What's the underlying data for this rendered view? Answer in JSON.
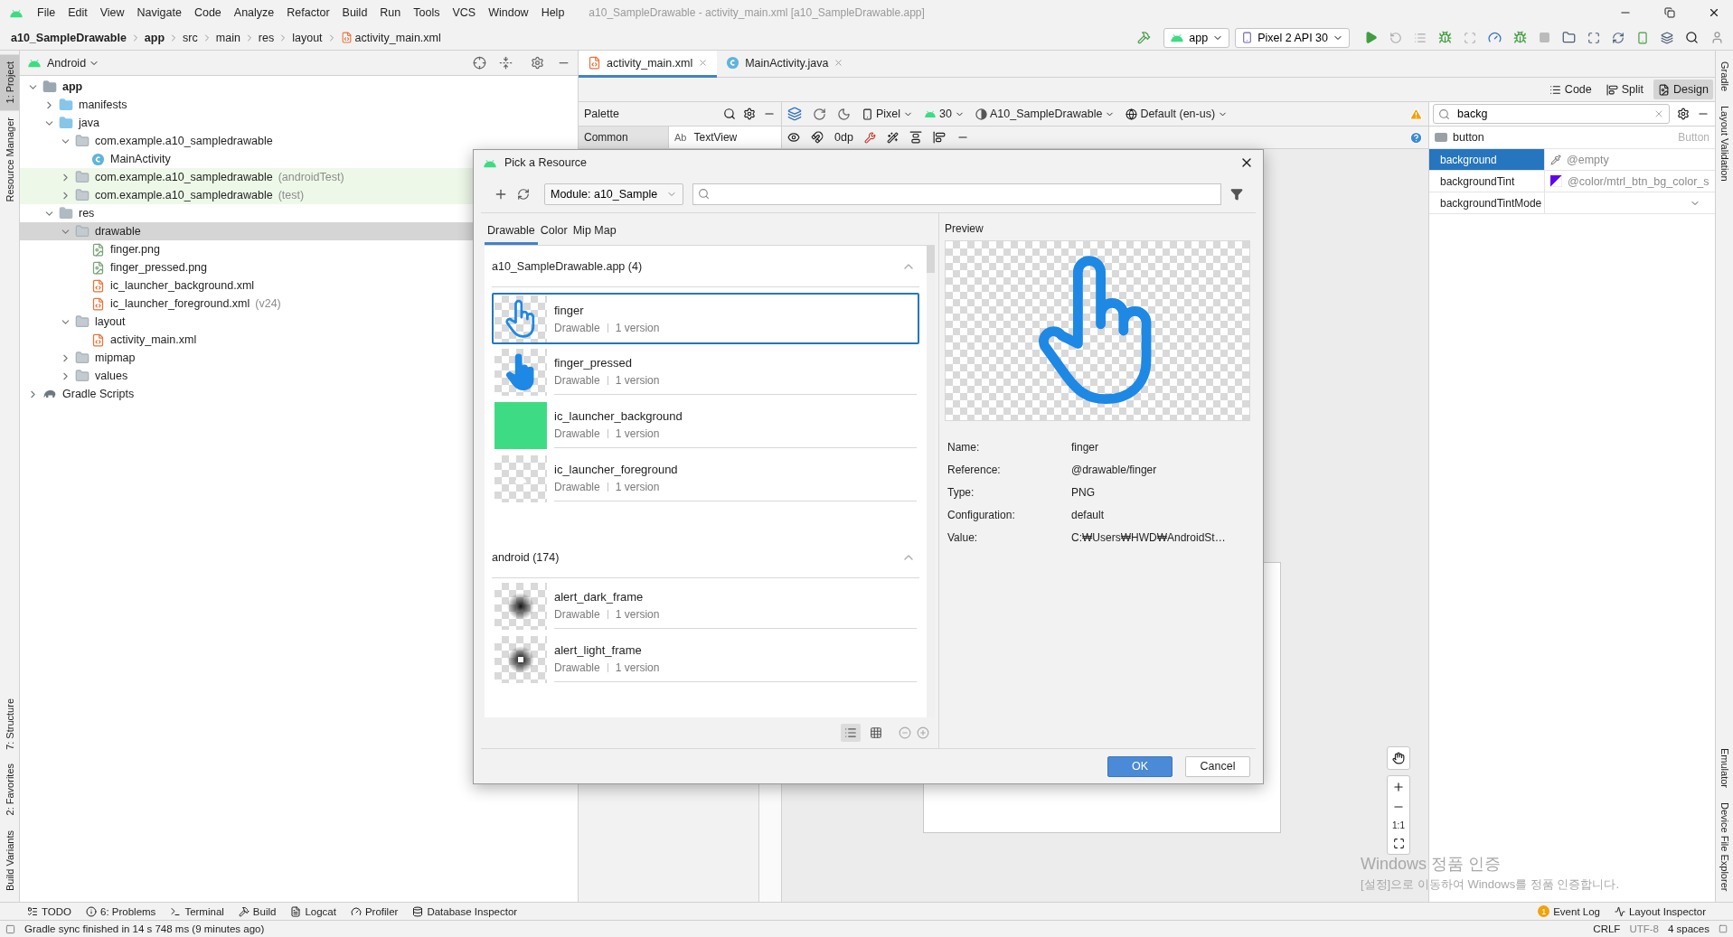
{
  "menu": [
    "File",
    "Edit",
    "View",
    "Navigate",
    "Code",
    "Analyze",
    "Refactor",
    "Build",
    "Run",
    "Tools",
    "VCS",
    "Window",
    "Help"
  ],
  "window_title": "a10_SampleDrawable - activity_main.xml [a10_SampleDrawable.app]",
  "breadcrumbs": [
    {
      "label": "a10_SampleDrawable",
      "kind": "project"
    },
    {
      "label": "app",
      "kind": "module"
    },
    {
      "label": "src",
      "kind": "dir"
    },
    {
      "label": "main",
      "kind": "dir"
    },
    {
      "label": "res",
      "kind": "dir"
    },
    {
      "label": "layout",
      "kind": "dir"
    },
    {
      "label": "activity_main.xml",
      "kind": "xml"
    }
  ],
  "run_config": "app",
  "device": "Pixel 2 API 30",
  "left_strip": {
    "top": [
      {
        "label": "1: Project",
        "selected": true
      },
      {
        "label": "Resource Manager",
        "selected": false
      }
    ],
    "bottom": [
      {
        "label": "7: Structure",
        "selected": false
      },
      {
        "label": "2: Favorites",
        "selected": false
      },
      {
        "label": "Build Variants",
        "selected": false
      }
    ]
  },
  "project": {
    "view": "Android",
    "tree": [
      {
        "label": "app",
        "kind": "module",
        "expanded": true,
        "selected": false,
        "highlighted": false,
        "children": [
          {
            "label": "manifests",
            "kind": "source-folder",
            "expanded": false,
            "selected": false,
            "highlighted": false
          },
          {
            "label": "java",
            "kind": "source-folder",
            "expanded": true,
            "selected": false,
            "highlighted": false,
            "children": [
              {
                "label": "com.example.a10_sampledrawable",
                "kind": "package",
                "expanded": true,
                "selected": false,
                "highlighted": false,
                "children": [
                  {
                    "label": "MainActivity",
                    "kind": "class",
                    "selected": false,
                    "highlighted": false
                  }
                ]
              },
              {
                "label": "com.example.a10_sampledrawable",
                "suffix": "(androidTest)",
                "kind": "package",
                "expanded": false,
                "selected": false,
                "highlighted": true
              },
              {
                "label": "com.example.a10_sampledrawable",
                "suffix": "(test)",
                "kind": "package",
                "expanded": false,
                "selected": false,
                "highlighted": true
              }
            ]
          },
          {
            "label": "res",
            "kind": "res-folder",
            "expanded": true,
            "selected": false,
            "highlighted": false,
            "children": [
              {
                "label": "drawable",
                "kind": "package",
                "expanded": true,
                "selected": true,
                "highlighted": false,
                "children": [
                  {
                    "label": "finger.png",
                    "kind": "image",
                    "selected": false,
                    "highlighted": false
                  },
                  {
                    "label": "finger_pressed.png",
                    "kind": "image",
                    "selected": false,
                    "highlighted": false
                  },
                  {
                    "label": "ic_launcher_background.xml",
                    "kind": "xml",
                    "selected": false,
                    "highlighted": false
                  },
                  {
                    "label": "ic_launcher_foreground.xml",
                    "suffix": "(v24)",
                    "kind": "xml",
                    "selected": false,
                    "highlighted": false
                  }
                ]
              },
              {
                "label": "layout",
                "kind": "package",
                "expanded": true,
                "selected": false,
                "highlighted": false,
                "children": [
                  {
                    "label": "activity_main.xml",
                    "kind": "xml",
                    "selected": false,
                    "highlighted": false
                  }
                ]
              },
              {
                "label": "mipmap",
                "kind": "package",
                "expanded": false,
                "selected": false,
                "highlighted": false
              },
              {
                "label": "values",
                "kind": "package",
                "expanded": false,
                "selected": false,
                "highlighted": false
              }
            ]
          }
        ]
      },
      {
        "label": "Gradle Scripts",
        "kind": "gradle",
        "expanded": false,
        "selected": false,
        "highlighted": false
      }
    ]
  },
  "editor_tabs": [
    {
      "label": "activity_main.xml",
      "kind": "xml",
      "selected": true
    },
    {
      "label": "MainActivity.java",
      "kind": "class",
      "selected": false
    }
  ],
  "view_modes": [
    {
      "label": "Code",
      "selected": false
    },
    {
      "label": "Split",
      "selected": false
    },
    {
      "label": "Design",
      "selected": true
    }
  ],
  "palette": {
    "title": "Palette",
    "categories": [
      {
        "label": "Common",
        "selected": true
      }
    ],
    "items": [
      {
        "prefix": "Ab",
        "label": "TextView"
      }
    ]
  },
  "design_toolbar": {
    "device": "Pixel",
    "api": "30",
    "theme": "A10_SampleDrawable",
    "locale": "Default (en-us)",
    "margin": "0dp"
  },
  "attributes": {
    "search": "backg",
    "component": "button",
    "component_type": "Button",
    "rows": [
      {
        "name": "background",
        "value": "@empty",
        "kind": "drawable",
        "selected": true
      },
      {
        "name": "backgroundTint",
        "value": "@color/mtrl_btn_bg_color_s",
        "kind": "color",
        "selected": false
      },
      {
        "name": "backgroundTintMode",
        "kind": "enum",
        "selected": false
      }
    ]
  },
  "right_strip": {
    "top": [
      "Gradle",
      "Layout Validation"
    ],
    "bottom": [
      "Emulator",
      "Device File Explorer"
    ]
  },
  "zoom_label": "1:1",
  "dialog": {
    "title": "Pick a Resource",
    "module": "Module: a10_Sample",
    "tabs": [
      {
        "label": "Drawable",
        "selected": true
      },
      {
        "label": "Color",
        "selected": false
      },
      {
        "label": "Mip Map",
        "selected": false
      }
    ],
    "groups": [
      {
        "title": "a10_SampleDrawable.app (4)",
        "expanded": true,
        "items": [
          {
            "name": "finger",
            "type": "Drawable",
            "versions": "1 version",
            "kind": "outline",
            "selected": true
          },
          {
            "name": "finger_pressed",
            "type": "Drawable",
            "versions": "1 version",
            "kind": "filled",
            "selected": false
          },
          {
            "name": "ic_launcher_background",
            "type": "Drawable",
            "versions": "1 version",
            "kind": "green",
            "selected": false
          },
          {
            "name": "ic_launcher_foreground",
            "type": "Drawable",
            "versions": "1 version",
            "kind": "robot",
            "selected": false
          }
        ]
      },
      {
        "title": "android (174)",
        "expanded": true,
        "items": [
          {
            "name": "alert_dark_frame",
            "type": "Drawable",
            "versions": "1 version",
            "kind": "dark",
            "selected": false
          },
          {
            "name": "alert_light_frame",
            "type": "Drawable",
            "versions": "1 version",
            "kind": "light",
            "selected": false
          }
        ]
      }
    ],
    "view_modes": [
      {
        "kind": "list",
        "selected": true
      },
      {
        "kind": "grid",
        "selected": false
      }
    ],
    "preview_title": "Preview",
    "preview": {
      "kind": "outline"
    },
    "details": [
      {
        "label": "Name:",
        "value": "finger"
      },
      {
        "label": "Reference:",
        "value": "@drawable/finger"
      },
      {
        "label": "Type:",
        "value": "PNG"
      },
      {
        "label": "Configuration:",
        "value": "default"
      },
      {
        "label": "Value:",
        "value": "C:₩Users₩HWD₩AndroidSt…"
      }
    ],
    "buttons": [
      {
        "label": "OK",
        "primary": true
      },
      {
        "label": "Cancel",
        "primary": false
      }
    ]
  },
  "bottom_tools": [
    {
      "label": "TODO",
      "kind": "todo"
    },
    {
      "label": "6: Problems",
      "kind": "problems"
    },
    {
      "label": "Terminal",
      "kind": "terminal"
    },
    {
      "label": "Build",
      "kind": "build"
    },
    {
      "label": "Logcat",
      "kind": "logcat"
    },
    {
      "label": "Profiler",
      "kind": "profiler"
    },
    {
      "label": "Database Inspector",
      "kind": "database"
    }
  ],
  "right_tools": [
    {
      "label": "Event Log",
      "badge": "1"
    },
    {
      "label": "Layout Inspector"
    }
  ],
  "status": {
    "message": "Gradle sync finished in 14 s 748 ms (9 minutes ago)",
    "items": [
      "CRLF",
      "UTF-8",
      "4 spaces"
    ]
  },
  "activation": {
    "title": "Windows 정품 인증",
    "text": "[설정]으로 이동하여 Windows를 정품 인증합니다."
  }
}
